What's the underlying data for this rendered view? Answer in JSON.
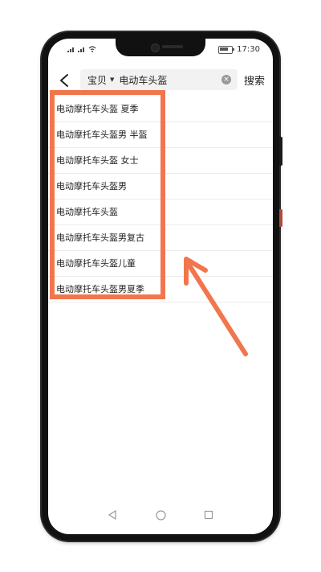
{
  "status_bar": {
    "time": "17:30"
  },
  "search": {
    "scope": "宝贝",
    "query": "电动车头盔",
    "search_label": "搜索"
  },
  "suggestions": [
    "电动摩托车头盔 夏季",
    "电动摩托车头盔男 半盔",
    "电动摩托车头盔 女士",
    "电动摩托车头盔男",
    "电动摩托车头盔",
    "电动摩托车头盔男复古",
    "电动摩托车头盔儿童",
    "电动摩托车头盔男夏季"
  ],
  "colors": {
    "highlight": "#f2764d",
    "arrow": "#f2764d"
  },
  "icons": {
    "back": "chevron-left-icon",
    "clear": "clear-icon",
    "nav_back": "triangle-back-icon",
    "nav_home": "circle-home-icon",
    "nav_recent": "square-recent-icon"
  }
}
